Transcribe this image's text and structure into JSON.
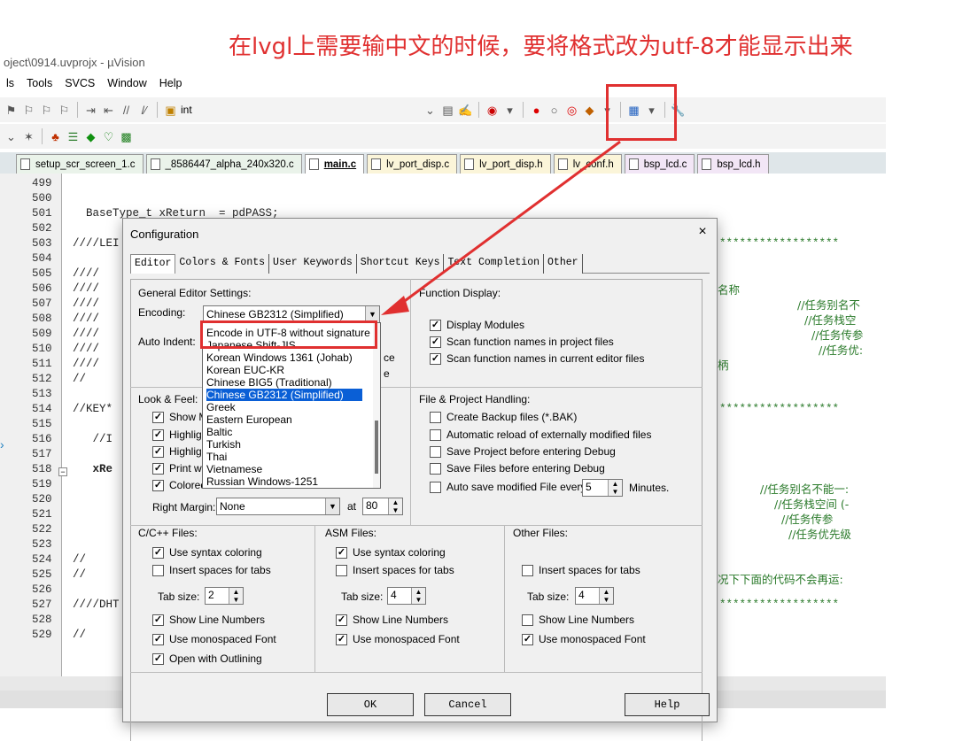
{
  "annotation": "在lvgl上需要输中文的时候，要将格式改为utf-8才能显示出来",
  "window": {
    "title": "oject\\0914.uvprojx - µVision"
  },
  "menu": [
    "ls",
    "Tools",
    "SVCS",
    "Window",
    "Help"
  ],
  "toolbar": {
    "target_text": "int"
  },
  "tabs": [
    {
      "label": "setup_scr_screen_1.c",
      "kind": "c"
    },
    {
      "label": "_8586447_alpha_240x320.c",
      "kind": "c"
    },
    {
      "label": "main.c",
      "kind": "c",
      "active": true
    },
    {
      "label": "lv_port_disp.c",
      "kind": "h"
    },
    {
      "label": "lv_port_disp.h",
      "kind": "h"
    },
    {
      "label": "lv_conf.h",
      "kind": "h"
    },
    {
      "label": "bsp_lcd.c",
      "kind": "p"
    },
    {
      "label": "bsp_lcd.h",
      "kind": "p"
    }
  ],
  "editor": {
    "line_numbers": [
      "499",
      "500",
      "501",
      "502",
      "503",
      "504",
      "505",
      "506",
      "507",
      "508",
      "509",
      "510",
      "511",
      "512",
      "513",
      "514",
      "515",
      "516",
      "517",
      "518",
      "519",
      "520",
      "521",
      "522",
      "523",
      "524",
      "525",
      "526",
      "527",
      "528",
      "529"
    ],
    "code_501": "  BaseType_t xReturn  = pdPASS;",
    "code_503": "////LEI",
    "code_505": "////",
    "code_506": "////",
    "code_507": "////",
    "code_508": "////",
    "code_509": "////",
    "code_510": "////",
    "code_511": "////",
    "code_512": "//",
    "code_514": "//KEY*",
    "code_516": "   //I",
    "code_518": "   xRe",
    "code_524": "//",
    "code_525": "//",
    "code_527": "////DHT",
    "code_529": "//",
    "stars": "******************",
    "cmt_506": "名称",
    "cmt_507": "//任务别名不",
    "cmt_508": "//任务栈空",
    "cmt_509": "//任务传参",
    "cmt_510": "//任务优:",
    "cmt_511": "柄",
    "cmt_519": "//任务别名不能一:",
    "cmt_520": "//任务栈空间 (-",
    "cmt_521": "//任务传参",
    "cmt_522": "//任务优先级",
    "cmt_525": "况下下面的代码不会再运:"
  },
  "dialog": {
    "title": "Configuration",
    "close": "×",
    "tabs": [
      "Editor",
      "Colors & Fonts",
      "User Keywords",
      "Shortcut Keys",
      "Text Completion",
      "Other"
    ],
    "general_label": "General Editor Settings:",
    "encoding_label": "Encoding:",
    "encoding_value": "Chinese GB2312 (Simplified)",
    "auto_indent_label": "Auto Indent:",
    "auto_indent_partial_1": "ce",
    "auto_indent_partial_2": "e",
    "function_display_label": "Function Display:",
    "display_modules": "Display Modules",
    "scan_project": "Scan function names in project files",
    "scan_editor": "Scan function names in current editor files",
    "look_feel_label": "Look & Feel:",
    "lf_items": [
      "Show M",
      "Highligh",
      "Highligh",
      "Print wit",
      "Colored"
    ],
    "right_margin_label": "Right Margin:",
    "right_margin_value": "None",
    "at_label": "at",
    "at_value": "80",
    "file_project_label": "File & Project Handling:",
    "fp_backup": "Create Backup files (*.BAK)",
    "fp_reload": "Automatic reload of externally modified files",
    "fp_save_project": "Save Project before entering Debug",
    "fp_save_files": "Save Files before entering Debug",
    "fp_autosave": "Auto save modified File every",
    "fp_autosave_value": "5",
    "fp_minutes": "Minutes.",
    "cc_label": "C/C++ Files:",
    "asm_label": "ASM Files:",
    "other_label": "Other Files:",
    "syntax": "Use syntax coloring",
    "spaces": "Insert spaces for tabs",
    "tab_size": "Tab size:",
    "cc_tab_size": "2",
    "asm_tab_size": "4",
    "other_tab_size": "4",
    "line_numbers": "Show Line Numbers",
    "monospaced": "Use monospaced Font",
    "outlining": "Open with Outlining",
    "ok": "OK",
    "cancel": "Cancel",
    "help": "Help"
  },
  "encoding_options": [
    "Encode in UTF-8 without signature",
    "Japanese Shift-JIS",
    "Korean Windows 1361 (Johab)",
    "Korean EUC-KR",
    "Chinese BIG5 (Traditional)",
    "Chinese GB2312 (Simplified)",
    "Greek",
    "Eastern European",
    "Baltic",
    "Turkish",
    "Thai",
    "Vietnamese",
    "Russian Windows-1251"
  ],
  "colors": {
    "annotation": "#e03030",
    "selection": "#0a5fd6"
  }
}
